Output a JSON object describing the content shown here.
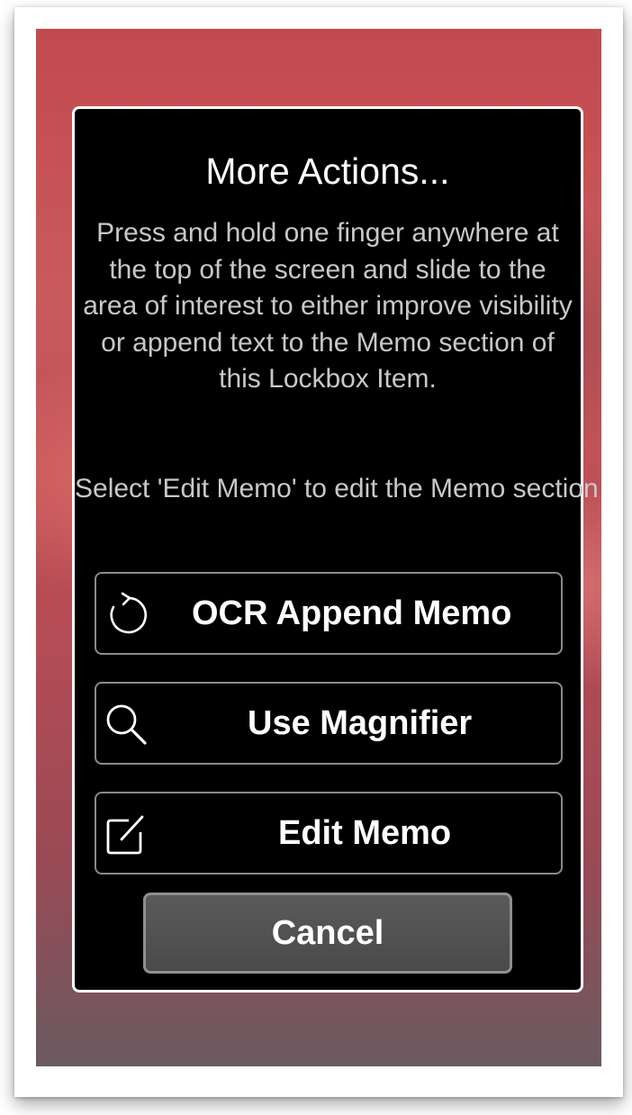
{
  "dialog": {
    "title": "More Actions...",
    "description": "Press and hold one finger anywhere at the top of the screen and slide to the area of interest to either improve visibility or append text to the Memo section of this Lockbox Item.",
    "edit_hint": "Select 'Edit Memo' to edit the Memo section using the keyboard.",
    "actions": [
      {
        "label": "OCR Append Memo",
        "icon": "refresh-icon"
      },
      {
        "label": "Use Magnifier",
        "icon": "magnifier-icon"
      },
      {
        "label": "Edit Memo",
        "icon": "edit-icon"
      }
    ],
    "cancel_label": "Cancel"
  },
  "colors": {
    "dialog_background": "#000000",
    "dialog_border": "#ffffff",
    "description_text": "#c8c8c8",
    "cancel_background": "#4f4f4f",
    "backdrop": "#c24a4f"
  }
}
